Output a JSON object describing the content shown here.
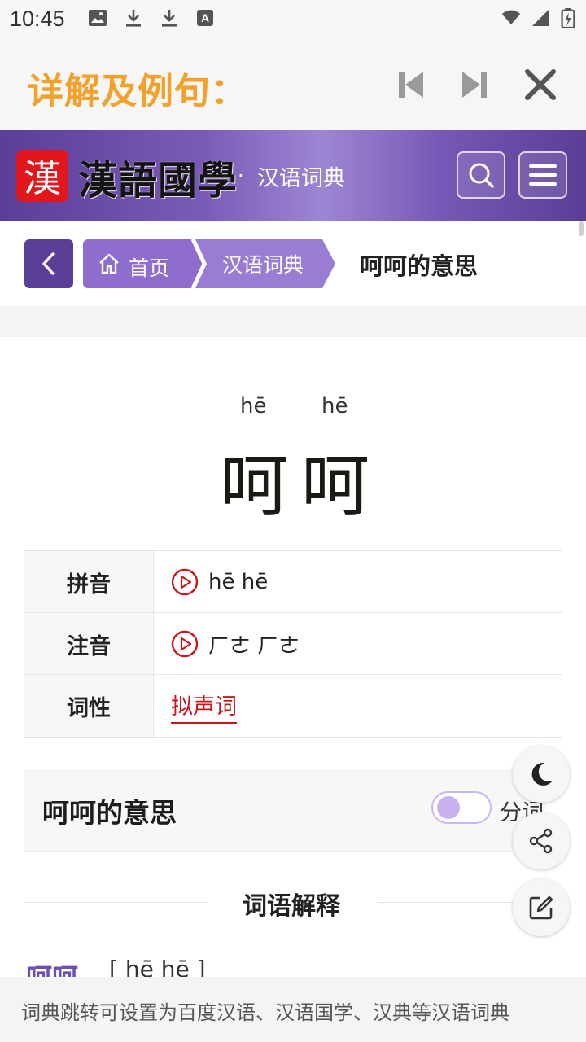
{
  "status_bar": {
    "time": "10:45",
    "left_icons": [
      "image-icon",
      "download-icon",
      "download-icon",
      "font-icon"
    ],
    "right_icons": [
      "wifi-icon",
      "signal-icon",
      "battery-charging-icon"
    ]
  },
  "top_bar": {
    "title": "详解及例句：",
    "title_color": "#f2a12a",
    "buttons": [
      "skip-previous-icon",
      "skip-next-icon",
      "close-icon"
    ]
  },
  "site_header": {
    "logo_char": "漢",
    "logo_text": "漢語國學",
    "dot": "·",
    "subtitle": "汉语词典",
    "buttons": [
      "search-icon",
      "menu-icon"
    ],
    "brand_color": "#5a3e98"
  },
  "breadcrumb": {
    "items": [
      "首页",
      "汉语词典"
    ],
    "current": "呵呵的意思"
  },
  "word": {
    "chars": [
      "呵",
      "呵"
    ],
    "pinyin": [
      "hē",
      "hē"
    ]
  },
  "info_table": {
    "rows": [
      {
        "label": "拼音",
        "value": "hē hē"
      },
      {
        "label": "注音",
        "value": "ㄏㄜ ㄏㄜ"
      },
      {
        "label": "词性",
        "value": "拟声词"
      }
    ]
  },
  "meaning_section": {
    "title": "呵呵的意思",
    "toggle_label": "分词",
    "toggle_on": false
  },
  "explanation": {
    "title": "词语解释",
    "entry_word": "呵呵",
    "entry_pinyin": "[ hē hē ]"
  },
  "floating_buttons": [
    "dark-mode-icon",
    "share-icon",
    "edit-icon"
  ],
  "notice": "词典跳转可设置为百度汉语、汉语国学、汉典等汉语词典"
}
